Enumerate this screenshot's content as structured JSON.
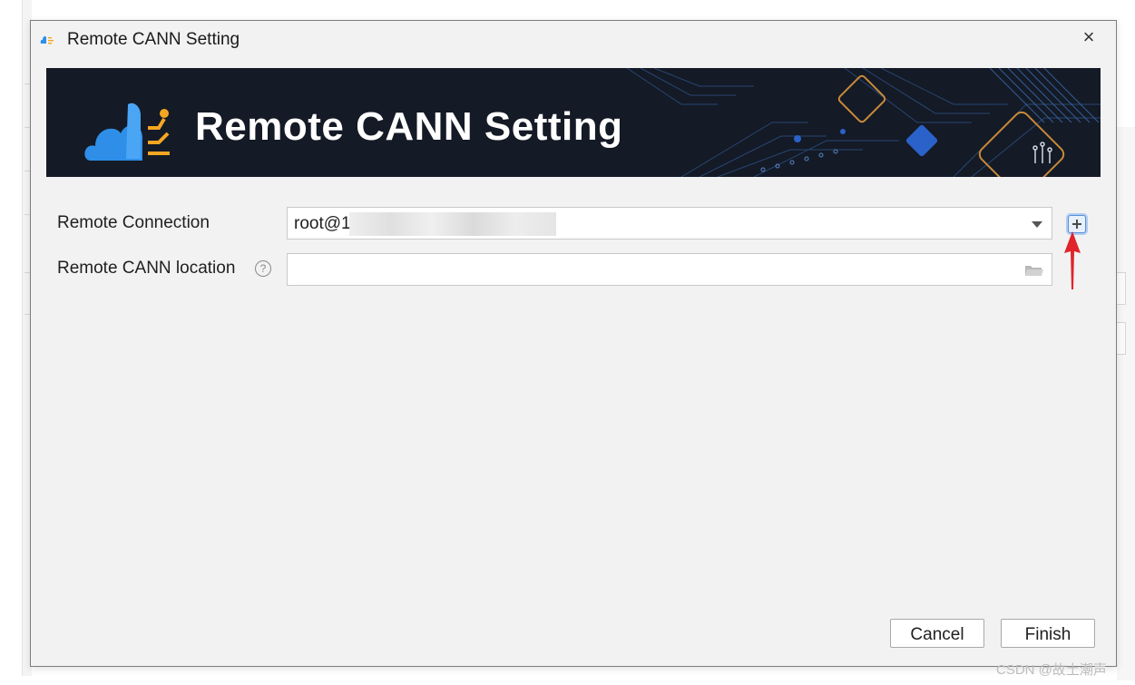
{
  "window": {
    "title": "Remote CANN Setting",
    "close_glyph": "×"
  },
  "banner": {
    "title": "Remote CANN Setting"
  },
  "form": {
    "remote_connection": {
      "label": "Remote Connection",
      "value": "root@1"
    },
    "cann_location": {
      "label": "Remote CANN location",
      "help_glyph": "?",
      "value": ""
    }
  },
  "footer": {
    "cancel_label": "Cancel",
    "finish_label": "Finish"
  },
  "watermark": "CSDN @故土潮声",
  "icons": [
    "cann-logo-icon",
    "close-icon",
    "help-icon",
    "dropdown-arrow-icon",
    "add-connection-icon",
    "folder-icon",
    "red-arrow-annotation"
  ],
  "colors": {
    "banner_bg": "#141a26",
    "accent_orange": "#f5a623",
    "logo_blue": "#2f8fe8",
    "annotation_red": "#e0242b"
  }
}
